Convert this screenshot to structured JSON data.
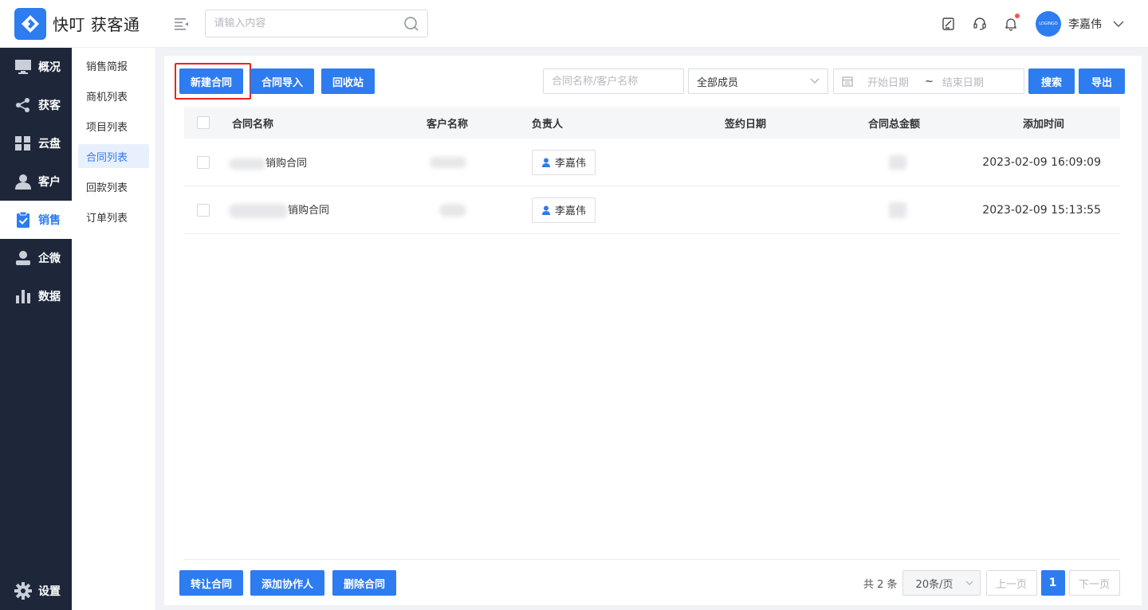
{
  "header": {
    "brand": "快叮 获客通",
    "search_placeholder": "请输入内容",
    "username": "李嘉伟",
    "avatar_text": "LOGINGO"
  },
  "sidebar": {
    "items": [
      {
        "label": "概况",
        "icon": "monitor-icon"
      },
      {
        "label": "获客",
        "icon": "share-icon"
      },
      {
        "label": "云盘",
        "icon": "grid-icon"
      },
      {
        "label": "客户",
        "icon": "user-icon"
      },
      {
        "label": "销售",
        "icon": "clipboard-check-icon",
        "active": true
      },
      {
        "label": "企微",
        "icon": "person-icon"
      },
      {
        "label": "数据",
        "icon": "bar-chart-icon"
      }
    ],
    "settings_label": "设置"
  },
  "submenu": {
    "items": [
      "销售简报",
      "商机列表",
      "项目列表",
      "合同列表",
      "回款列表",
      "订单列表"
    ],
    "active_index": 3
  },
  "toolbar": {
    "new_contract": "新建合同",
    "import_contract": "合同导入",
    "recycle_bin": "回收站",
    "name_placeholder": "合同名称/客户名称",
    "member_select": "全部成员",
    "start_date_placeholder": "开始日期",
    "date_separator": "~",
    "end_date_placeholder": "结束日期",
    "search": "搜索",
    "export": "导出"
  },
  "table": {
    "columns": [
      "合同名称",
      "客户名称",
      "负责人",
      "签约日期",
      "合同总金额",
      "添加时间"
    ],
    "rows": [
      {
        "name_suffix": "销购合同",
        "owner": "李嘉伟",
        "sign_date": "",
        "added": "2023-02-09 16:09:09"
      },
      {
        "name_suffix": "销购合同",
        "owner": "李嘉伟",
        "sign_date": "",
        "added": "2023-02-09 15:13:55"
      }
    ]
  },
  "footer": {
    "transfer": "转让合同",
    "add_collaborator": "添加协作人",
    "delete": "删除合同",
    "total": "共 2 条",
    "page_size": "20条/页",
    "prev": "上一页",
    "current_page": "1",
    "next": "下一页"
  },
  "colors": {
    "primary": "#2d7cf0",
    "sidebar_bg": "#1d2739",
    "highlight": "#e7261f"
  }
}
